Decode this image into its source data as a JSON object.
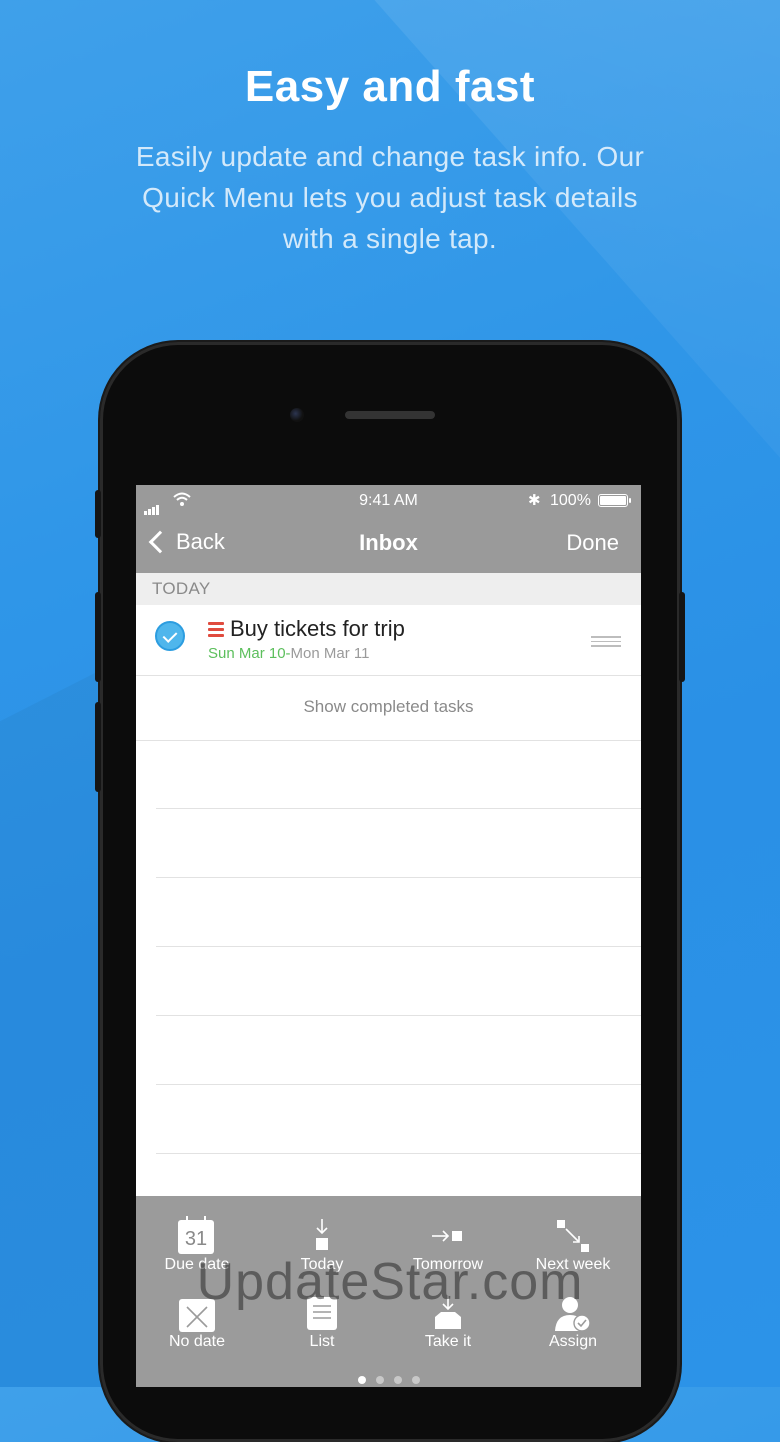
{
  "promo": {
    "headline": "Easy and fast",
    "subline": "Easily update and change task info. Our Quick Menu lets you adjust task details with a single tap."
  },
  "status_bar": {
    "time": "9:41 AM",
    "battery": "100%"
  },
  "nav": {
    "back_label": "Back",
    "title": "Inbox",
    "done_label": "Done"
  },
  "section_header": "TODAY",
  "task": {
    "title": "Buy tickets for trip",
    "date_start": "Sun Mar 10",
    "date_separator": "-",
    "date_end": "Mon Mar 11",
    "completed": true
  },
  "show_completed_label": "Show completed tasks",
  "quick_menu": {
    "row1": [
      {
        "label": "Due date",
        "icon": "calendar-icon",
        "icon_text": "31"
      },
      {
        "label": "Today",
        "icon": "arrow-down-to-square-icon"
      },
      {
        "label": "Tomorrow",
        "icon": "arrow-right-to-square-icon"
      },
      {
        "label": "Next week",
        "icon": "diagonal-arrows-icon"
      }
    ],
    "row2": [
      {
        "label": "No date",
        "icon": "calendar-x-icon"
      },
      {
        "label": "List",
        "icon": "list-icon"
      },
      {
        "label": "Take it",
        "icon": "inbox-tray-icon"
      },
      {
        "label": "Assign",
        "icon": "person-check-icon"
      }
    ],
    "pages": 4,
    "active_page": 1
  },
  "watermark": "UpdateStar.com",
  "colors": {
    "background": "#2f96e8",
    "bar_gray": "#9a9a9a",
    "priority_red": "#e04b3e",
    "date_green": "#5cbf5c",
    "check_blue": "#4fb6ec"
  }
}
